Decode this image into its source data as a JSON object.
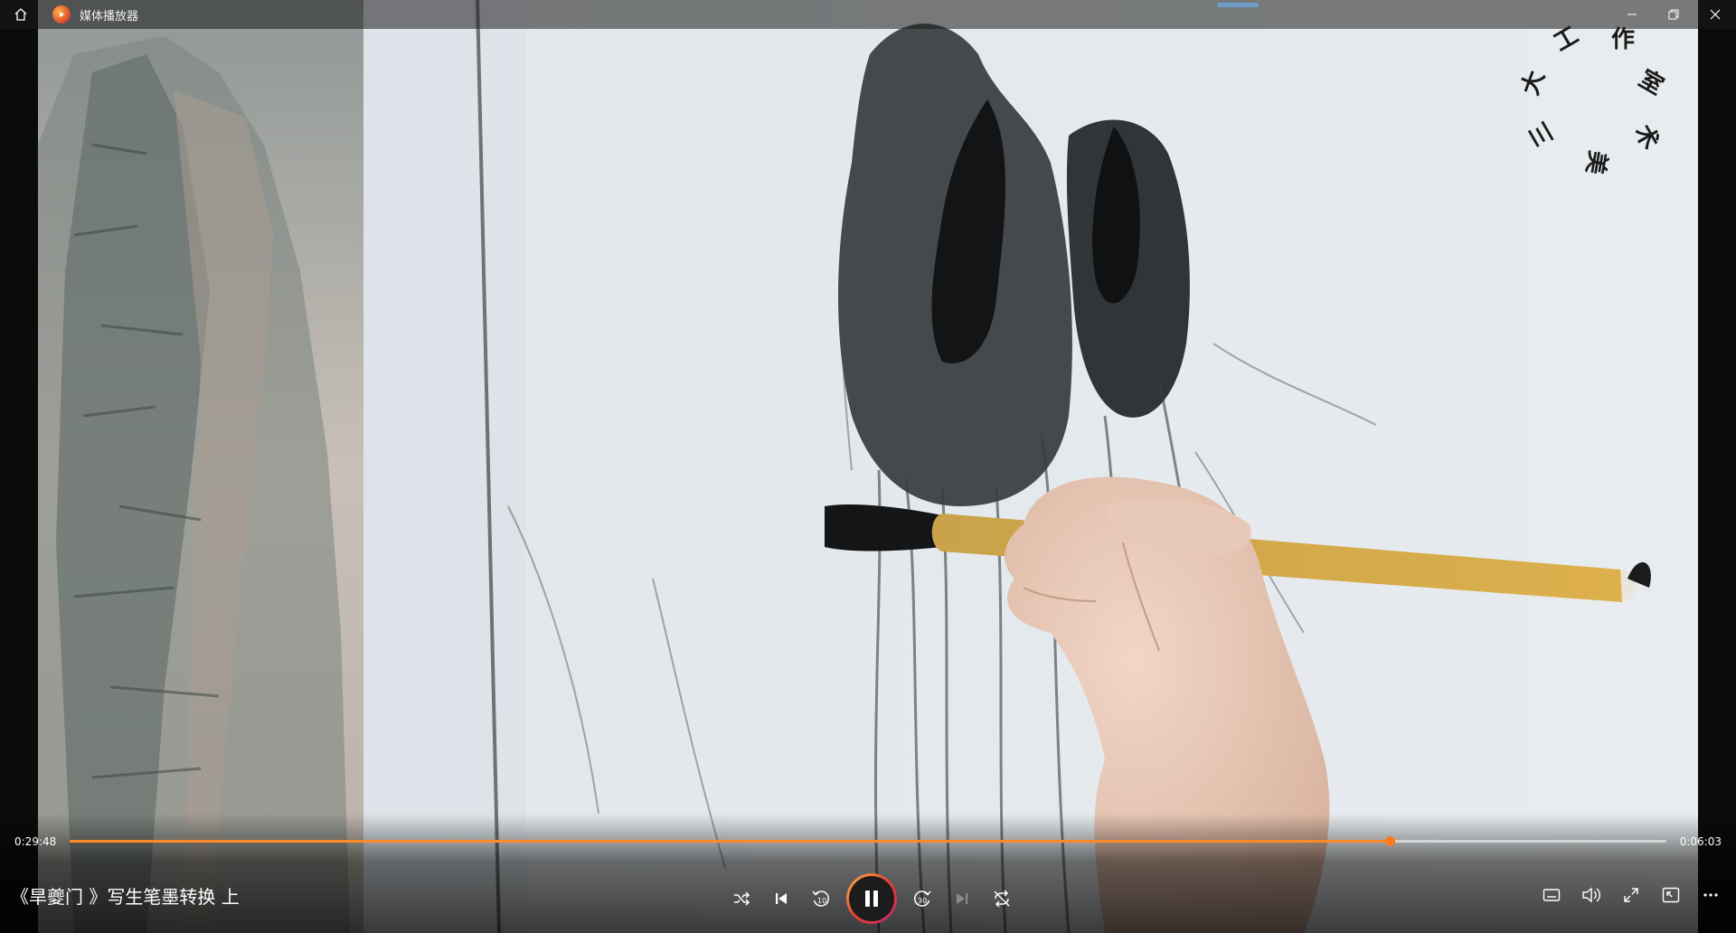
{
  "window": {
    "app_title": "媒体播放器",
    "icons": [
      "home-icon",
      "app-logo-icon",
      "minimize-icon",
      "restore-icon",
      "close-icon"
    ]
  },
  "player": {
    "elapsed": "0:29:48",
    "remaining": "0:06:03",
    "progress_fraction": 0.8265,
    "media_title": "《旱夔门 》写生笔墨转换 上",
    "accent_color": "#ff8a2a",
    "watermark_chars": [
      "工",
      "作",
      "室",
      "术",
      "美",
      "三",
      "大"
    ]
  },
  "controls": {
    "left": [
      "shuffle-icon",
      "previous-icon",
      "rewind-10-icon",
      "pause-icon",
      "forward-30-icon",
      "next-icon",
      "repeat-off-icon"
    ],
    "rewind_label": "10",
    "forward_label": "30",
    "right": [
      "captions-icon",
      "volume-icon",
      "fullscreen-icon",
      "mini-view-icon",
      "more-icon"
    ]
  }
}
